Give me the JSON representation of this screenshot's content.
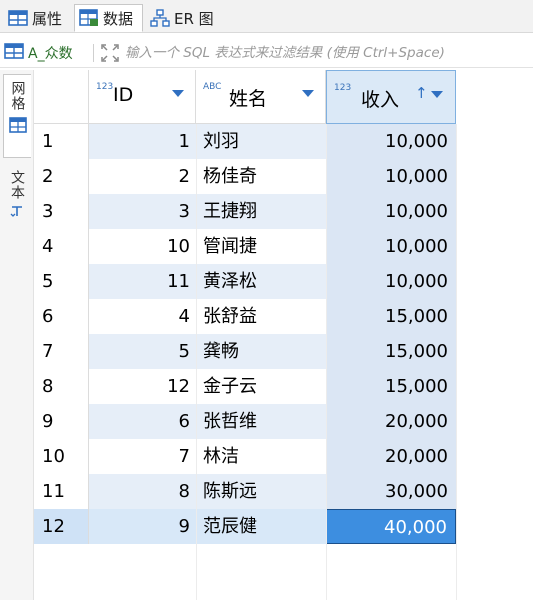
{
  "tabs": [
    {
      "label": "属性",
      "icon": "table-icon"
    },
    {
      "label": "数据",
      "icon": "data-grid-icon"
    },
    {
      "label": "ER 图",
      "icon": "er-diagram-icon"
    }
  ],
  "filter": {
    "table_name": "A_众数",
    "placeholder": "输入一个 SQL 表达式来过滤结果 (使用 Ctrl+Space)"
  },
  "side_tabs": [
    {
      "label": "网格",
      "icon": "grid-icon"
    },
    {
      "label": "文本",
      "icon": "text-icon"
    }
  ],
  "columns": [
    {
      "type": "123",
      "label": "ID"
    },
    {
      "type": "ABC",
      "label": "姓名"
    },
    {
      "type": "123",
      "label": "收入",
      "sorted": "ascending"
    }
  ],
  "rows": [
    {
      "n": "1",
      "id": "1",
      "name": "刘羽",
      "income": "10,000"
    },
    {
      "n": "2",
      "id": "2",
      "name": "杨佳奇",
      "income": "10,000"
    },
    {
      "n": "3",
      "id": "3",
      "name": "王捷翔",
      "income": "10,000"
    },
    {
      "n": "4",
      "id": "10",
      "name": "管闻捷",
      "income": "10,000"
    },
    {
      "n": "5",
      "id": "11",
      "name": "黄泽松",
      "income": "10,000"
    },
    {
      "n": "6",
      "id": "4",
      "name": "张舒益",
      "income": "15,000"
    },
    {
      "n": "7",
      "id": "5",
      "name": "龚畅",
      "income": "15,000"
    },
    {
      "n": "8",
      "id": "12",
      "name": "金子云",
      "income": "15,000"
    },
    {
      "n": "9",
      "id": "6",
      "name": "张哲维",
      "income": "20,000"
    },
    {
      "n": "10",
      "id": "7",
      "name": "林洁",
      "income": "20,000"
    },
    {
      "n": "11",
      "id": "8",
      "name": "陈斯远",
      "income": "30,000"
    },
    {
      "n": "12",
      "id": "9",
      "name": "范辰健",
      "income": "40,000"
    }
  ],
  "colors": {
    "accent": "#2f6fc1",
    "selected_cell": "#3d8ee0",
    "row_alt": "#e6eef8"
  }
}
